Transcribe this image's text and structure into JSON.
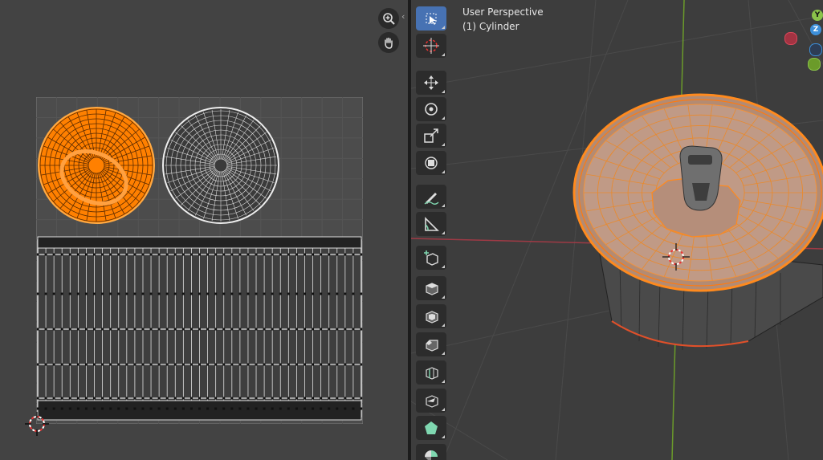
{
  "uv_editor": {
    "zoom_icon": "magnifier-plus-icon",
    "pan_icon": "hand-icon",
    "collapse_icon": "chevron-left-icon"
  },
  "viewport": {
    "perspective_label": "User Perspective",
    "object_label": "(1) Cylinder",
    "gizmo": {
      "y_label": "Y",
      "z_label": "Z"
    },
    "toolbar": [
      {
        "name": "select-box-tool",
        "icon": "select-box-icon",
        "active": true
      },
      {
        "name": "cursor-tool",
        "icon": "cursor-icon"
      },
      {
        "name": "move-tool",
        "icon": "move-icon"
      },
      {
        "name": "rotate-tool",
        "icon": "rotate-icon"
      },
      {
        "name": "scale-tool",
        "icon": "scale-icon"
      },
      {
        "name": "transform-tool",
        "icon": "transform-icon"
      },
      {
        "name": "annotate-tool",
        "icon": "annotate-icon"
      },
      {
        "name": "measure-tool",
        "icon": "measure-icon"
      },
      {
        "name": "add-cube-tool",
        "icon": "add-cube-icon"
      },
      {
        "name": "extrude-tool",
        "icon": "extrude-icon"
      },
      {
        "name": "inset-tool",
        "icon": "inset-icon"
      },
      {
        "name": "bevel-tool",
        "icon": "bevel-icon"
      },
      {
        "name": "loop-cut-tool",
        "icon": "loop-cut-icon"
      },
      {
        "name": "knife-tool",
        "icon": "knife-icon"
      },
      {
        "name": "poly-build-tool",
        "icon": "poly-build-icon"
      },
      {
        "name": "spin-tool",
        "icon": "spin-icon"
      }
    ]
  },
  "colors": {
    "selected": "#ff8000",
    "axis_x": "#c0414e",
    "axis_y": "#6b9b2a",
    "axis_z": "#3d8fd9",
    "toolbar_active": "#4772b3"
  }
}
